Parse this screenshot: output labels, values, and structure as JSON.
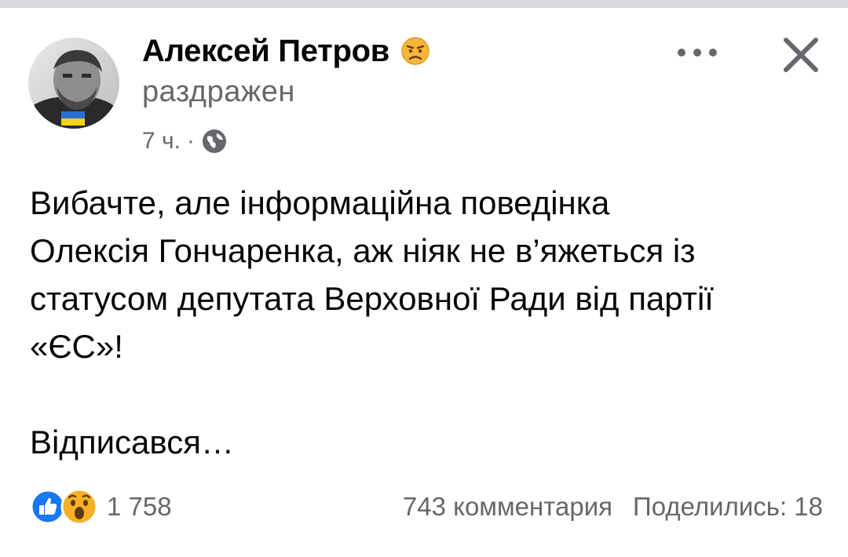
{
  "post": {
    "author": "Алексей Петров",
    "feeling": "раздражен",
    "time": "7 ч.",
    "separator": "·",
    "paragraphs": [
      "Вибачте, але інформаційна поведінка",
      "Олексія Гончаренка, аж ніяк не в’яжеться із",
      "статусом депутата Верховної Ради від партії",
      "«ЄС»!",
      "",
      "Відписався…"
    ],
    "reactions": {
      "icons": [
        "like-icon",
        "wow-icon"
      ],
      "count": "1 758"
    },
    "comments": "743 комментария",
    "shares": "Поделились: 18"
  },
  "icons": {
    "feeling": "annoyed-face-icon",
    "audience": "globe-icon",
    "more": "more-dots-icon",
    "close": "close-icon"
  },
  "colors": {
    "like": "#1877f2",
    "wow": "#f7b125",
    "secondary_text": "#65676b",
    "primary_text": "#050505"
  }
}
